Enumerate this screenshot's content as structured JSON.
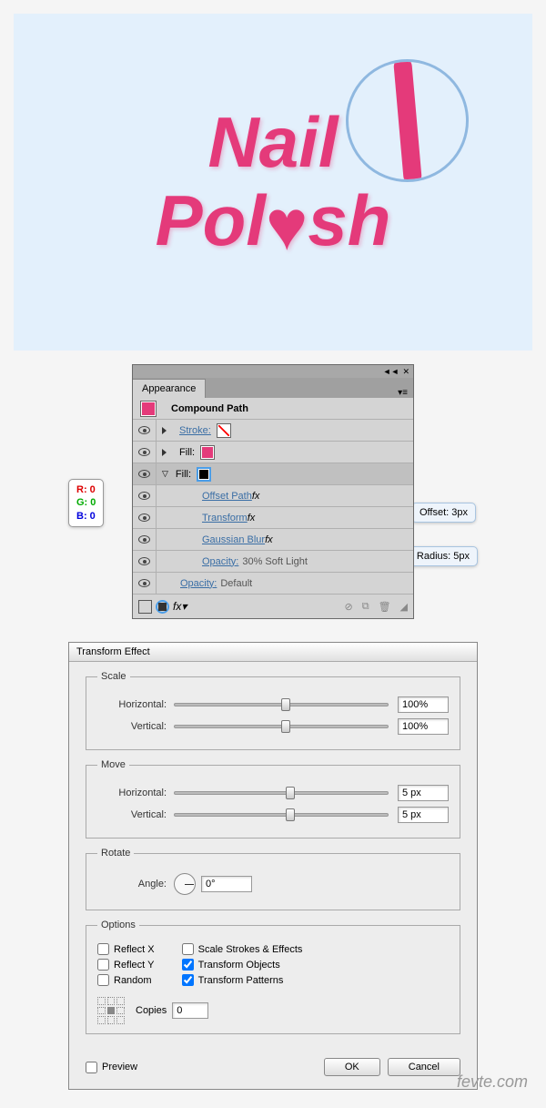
{
  "artwork": {
    "line1": "Nail",
    "line2": "Pol",
    "line3": "sh",
    "heart": "♥"
  },
  "rgb": {
    "r": "R: 0",
    "g": "G: 0",
    "b": "B: 0"
  },
  "callouts": {
    "offset": "Offset: 3px",
    "radius": "Radius: 5px"
  },
  "appearance": {
    "tab": "Appearance",
    "title": "Compound Path",
    "stroke_label": "Stroke:",
    "fill_label": "Fill:",
    "offset_path": "Offset Path",
    "transform": "Transform",
    "gaussian": "Gaussian Blur",
    "opacity_label": "Opacity:",
    "opacity_fill": "30% Soft Light",
    "opacity_default": "Default",
    "fx_symbol": "fx",
    "fx_btn": "fx▾"
  },
  "transform_dialog": {
    "title": "Transform Effect",
    "scale": {
      "legend": "Scale",
      "horizontal_label": "Horizontal:",
      "horizontal_value": "100%",
      "vertical_label": "Vertical:",
      "vertical_value": "100%"
    },
    "move": {
      "legend": "Move",
      "horizontal_label": "Horizontal:",
      "horizontal_value": "5 px",
      "vertical_label": "Vertical:",
      "vertical_value": "5 px"
    },
    "rotate": {
      "legend": "Rotate",
      "angle_label": "Angle:",
      "angle_value": "0°"
    },
    "options": {
      "legend": "Options",
      "reflect_x": "Reflect X",
      "reflect_y": "Reflect Y",
      "random": "Random",
      "scale_strokes": "Scale Strokes & Effects",
      "transform_objects": "Transform Objects",
      "transform_patterns": "Transform Patterns",
      "copies_label": "Copies",
      "copies_value": "0"
    },
    "preview": "Preview",
    "ok": "OK",
    "cancel": "Cancel"
  },
  "watermark": "fevte.com"
}
